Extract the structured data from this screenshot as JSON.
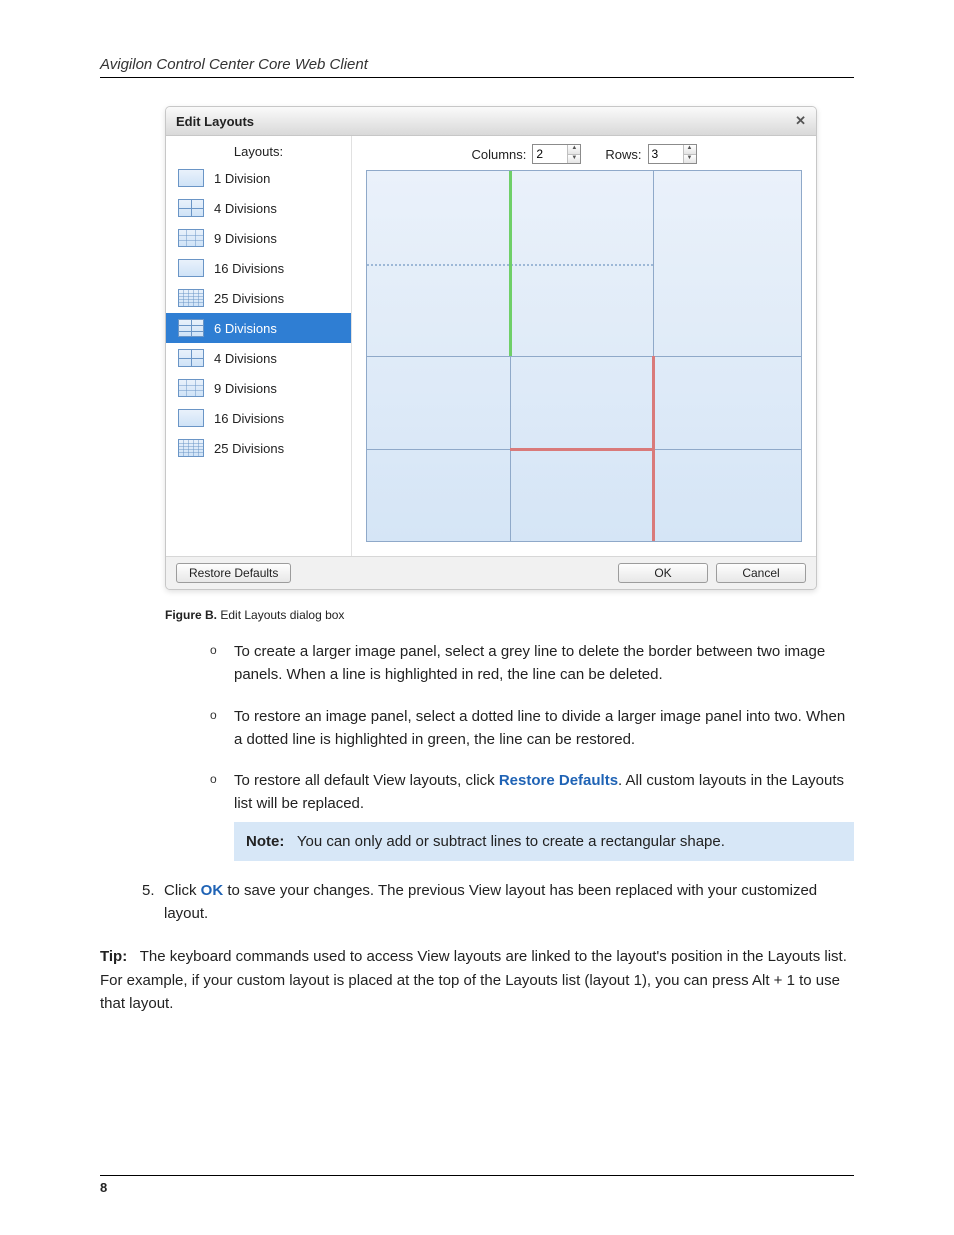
{
  "doc_header": "Avigilon Control Center Core Web Client",
  "dialog": {
    "title": "Edit Layouts",
    "layouts_label": "Layouts:",
    "columns_label": "Columns:",
    "rows_label": "Rows:",
    "columns_value": "2",
    "rows_value": "3",
    "items": [
      {
        "label": "1 Division",
        "icon": "ic-1"
      },
      {
        "label": "4 Divisions",
        "icon": "ic-4"
      },
      {
        "label": "9 Divisions",
        "icon": "ic-9"
      },
      {
        "label": "16 Divisions",
        "icon": "ic-16"
      },
      {
        "label": "25 Divisions",
        "icon": "ic-25"
      },
      {
        "label": "6 Divisions",
        "icon": "ic-6",
        "selected": true
      },
      {
        "label": "4 Divisions",
        "icon": "ic-4"
      },
      {
        "label": "9 Divisions",
        "icon": "ic-9"
      },
      {
        "label": "16 Divisions",
        "icon": "ic-16"
      },
      {
        "label": "25 Divisions",
        "icon": "ic-25"
      }
    ],
    "restore_btn": "Restore Defaults",
    "ok_btn": "OK",
    "cancel_btn": "Cancel"
  },
  "figure_caption_bold": "Figure B.",
  "figure_caption_rest": " Edit Layouts dialog box",
  "bullets": [
    "To create a larger image panel, select a grey line to delete the border between two image panels. When a line is highlighted in red, the line can be deleted.",
    "To restore an image panel, select a dotted line to divide a larger image panel into two. When a dotted line is highlighted in green, the line can be restored."
  ],
  "bullet3_pre": "To restore all default View layouts, click ",
  "bullet3_link": "Restore Defaults",
  "bullet3_post": ". All custom layouts in the Layouts list will be replaced.",
  "note_label": "Note:",
  "note_text": "You can only add or subtract lines to create a rectangular shape.",
  "step5_num": "5.",
  "step5_pre": "Click ",
  "step5_link": "OK",
  "step5_post": " to save your changes. The previous View layout has been replaced with your customized layout.",
  "tip_label": "Tip:",
  "tip_text": "The keyboard commands used to access View layouts are linked to the layout's position in the Layouts list. For example, if your custom layout is placed at the top of the Layouts list (layout 1), you can press Alt + 1 to use that layout.",
  "page_number": "8"
}
